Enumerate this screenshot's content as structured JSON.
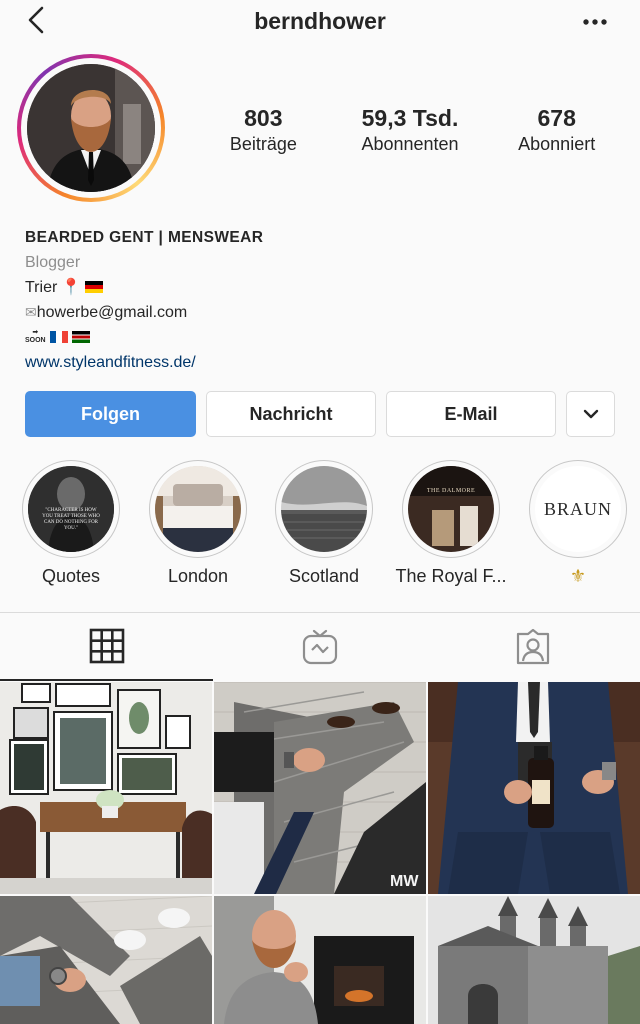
{
  "header": {
    "username": "berndhower"
  },
  "stats": [
    {
      "value": "803",
      "label": "Beiträge"
    },
    {
      "value": "59,3 Tsd.",
      "label": "Abonnenten"
    },
    {
      "value": "678",
      "label": "Abonniert"
    }
  ],
  "bio": {
    "name": "BEARDED GENT | MENSWEAR",
    "category": "Blogger",
    "location": "Trier",
    "email": "howerbe@gmail.com",
    "soon_label": "SOON",
    "website": "www.styleandfitness.de/"
  },
  "buttons": {
    "follow": "Folgen",
    "message": "Nachricht",
    "email": "E-Mail"
  },
  "highlights": [
    {
      "label": "Quotes",
      "image_text": "\"CHARACTER IS HOW YOU TREAT THOSE WHO CAN DO NOTHING FOR YOU.\""
    },
    {
      "label": "London"
    },
    {
      "label": "Scotland"
    },
    {
      "label": "The Royal F...",
      "image_text": "THE DALMORE"
    },
    {
      "label": "⚜",
      "image_text": "BRAUN"
    }
  ],
  "grid": {
    "watermark": "MW"
  },
  "colors": {
    "follow_button": "#4a90e2",
    "link": "#003569",
    "secondary_text": "#8e8e8e",
    "border": "#dbdbdb"
  }
}
